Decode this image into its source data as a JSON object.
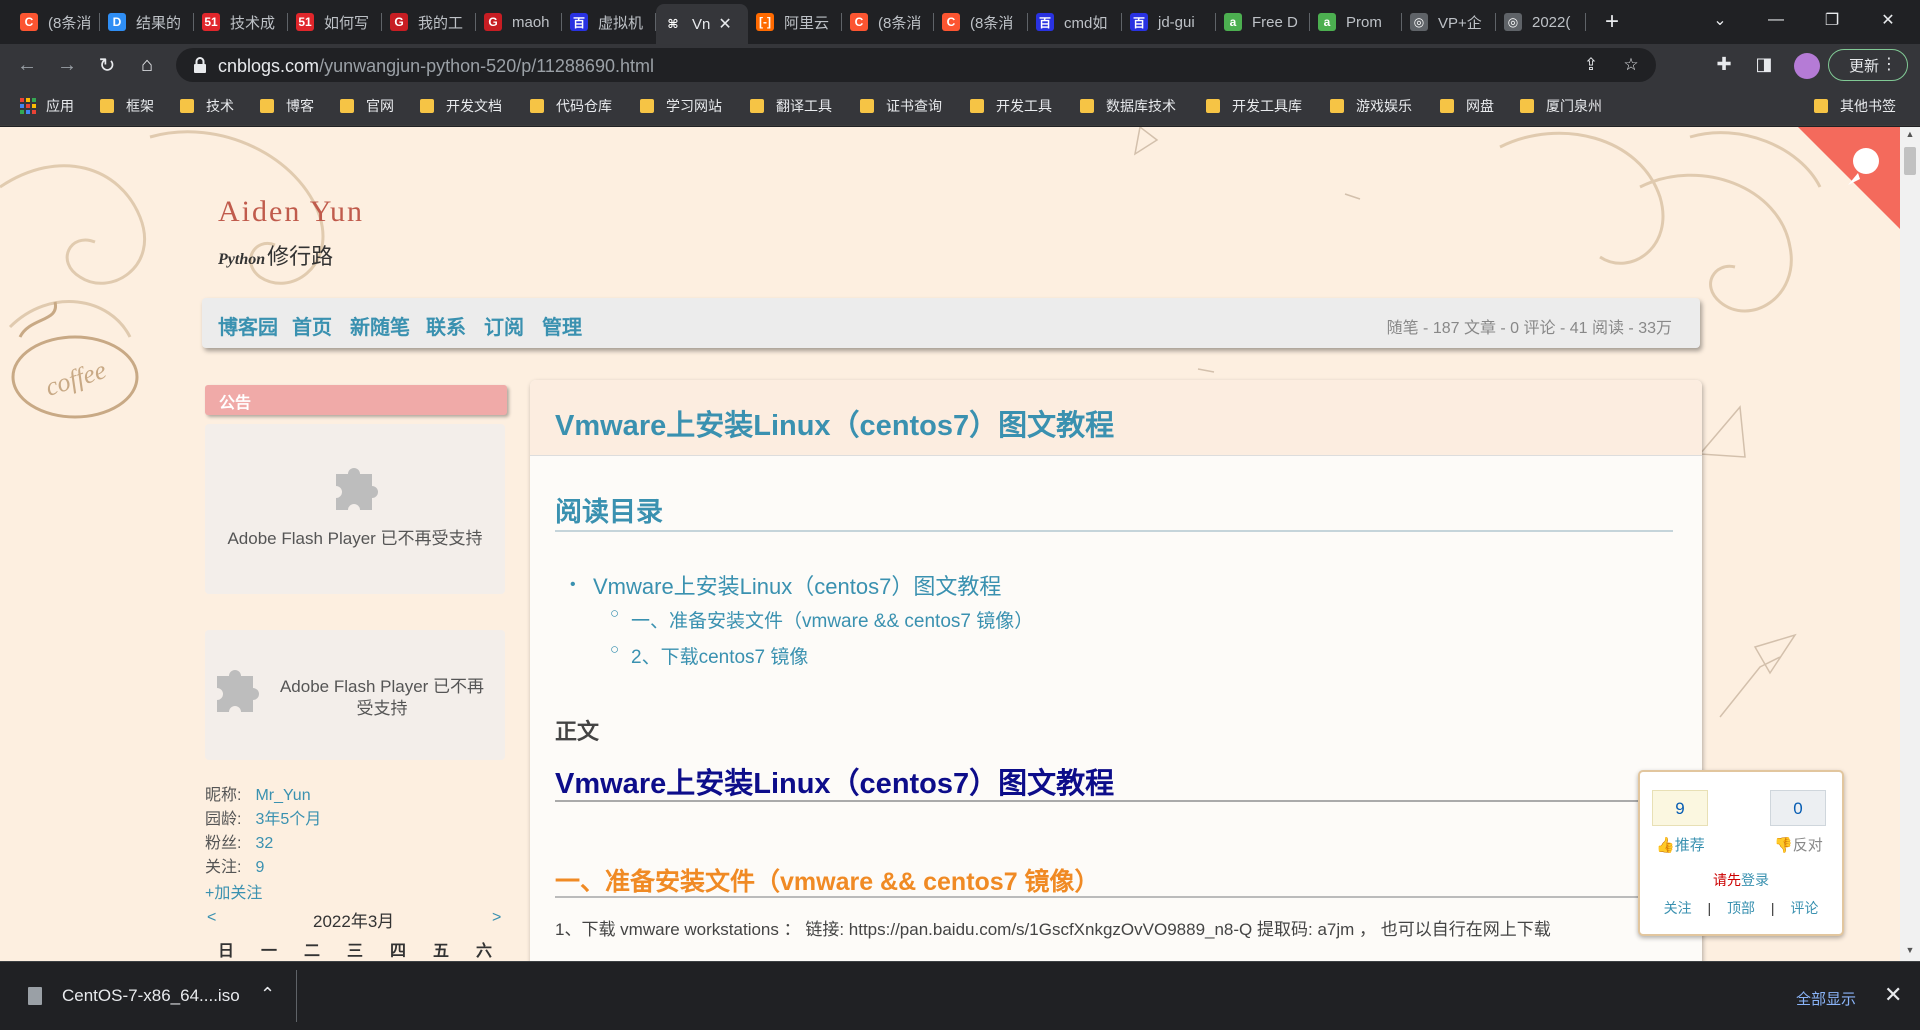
{
  "tabs": [
    {
      "label": "(8条消",
      "icon": "csdn-icon",
      "color": "#fc5531",
      "glyph": "C"
    },
    {
      "label": "结果的",
      "icon": "doc-icon",
      "color": "#2f8ef4",
      "glyph": "D"
    },
    {
      "label": "技术成",
      "icon": "51cto-icon",
      "color": "#e0262b",
      "glyph": "51"
    },
    {
      "label": "如何写",
      "icon": "51cto-icon",
      "color": "#e0262b",
      "glyph": "51"
    },
    {
      "label": "我的工",
      "icon": "gitee-icon",
      "color": "#c71d23",
      "glyph": "G"
    },
    {
      "label": "maoh",
      "icon": "gitee-icon",
      "color": "#c71d23",
      "glyph": "G"
    },
    {
      "label": "虚拟机",
      "icon": "baidu-icon",
      "color": "#2932e1",
      "glyph": "百"
    },
    {
      "label": "Vn",
      "icon": "cnblogs-icon",
      "color": "#35363a",
      "glyph": "⌘",
      "active": true
    },
    {
      "label": "阿里云",
      "icon": "aliyun-icon",
      "color": "#ff6a00",
      "glyph": "[-]"
    },
    {
      "label": "(8条消",
      "icon": "csdn-icon",
      "color": "#fc5531",
      "glyph": "C"
    },
    {
      "label": "(8条消",
      "icon": "csdn-icon",
      "color": "#fc5531",
      "glyph": "C"
    },
    {
      "label": "cmd如",
      "icon": "baidu-icon",
      "color": "#2932e1",
      "glyph": "百"
    },
    {
      "label": "jd-gui",
      "icon": "baidu-icon",
      "color": "#2932e1",
      "glyph": "百"
    },
    {
      "label": "Free D",
      "icon": "green-a-icon",
      "color": "#4caf50",
      "glyph": "a"
    },
    {
      "label": "Prom",
      "icon": "green-a-icon",
      "color": "#4caf50",
      "glyph": "a"
    },
    {
      "label": "VP+企",
      "icon": "globe-icon",
      "color": "#5f6368",
      "glyph": "◎"
    },
    {
      "label": "2022(",
      "icon": "globe-icon",
      "color": "#5f6368",
      "glyph": "◎"
    }
  ],
  "url": {
    "host": "cnblogs.com",
    "path": "/yunwangjun-python-520/p/11288690.html"
  },
  "update_label": "更新",
  "bookmarks": [
    "应用",
    "框架",
    "技术",
    "博客",
    "官网",
    "开发文档",
    "代码仓库",
    "学习网站",
    "翻译工具",
    "证书查询",
    "开发工具",
    "数据库技术",
    "开发工具库",
    "游戏娱乐",
    "网盘",
    "厦门泉州"
  ],
  "other_bookmarks": "其他书签",
  "blog": {
    "title": "Aiden Yun",
    "subtitle_script": "Python",
    "subtitle": "修行路"
  },
  "nav": {
    "links": [
      "博客园",
      "首页",
      "新随笔",
      "联系",
      "订阅",
      "管理"
    ],
    "stats": "随笔 - 187  文章 - 0  评论 - 41  阅读 - 33万"
  },
  "sidebar": {
    "notice_title": "公告",
    "flash1": "Adobe Flash Player 已不再受支持",
    "flash2": "Adobe Flash Player 已不再受支持",
    "profile": {
      "nickname_label": "昵称:",
      "nickname": "Mr_Yun",
      "age_label": "园龄:",
      "age": "3年5个月",
      "fans_label": "粉丝:",
      "fans": "32",
      "following_label": "关注:",
      "following": "9"
    },
    "follow_link": "+加关注",
    "calendar": {
      "prev": "<",
      "next": ">",
      "title": "2022年3月",
      "days": [
        "日",
        "一",
        "二",
        "三",
        "四",
        "五",
        "六"
      ]
    }
  },
  "post": {
    "title": "Vmware上安装Linux（centos7）图文教程",
    "toc_title": "阅读目录",
    "toc": [
      "Vmware上安装Linux（centos7）图文教程",
      "一、准备安装文件（vmware && centos7 镜像）",
      "2、下载centos7 镜像"
    ],
    "body_heading": "正文",
    "h1": "Vmware上安装Linux（centos7）图文教程",
    "h2": "一、准备安装文件（vmware && centos7 镜像）",
    "para": "1、下载  vmware workstations ： 链接: https://pan.baidu.com/s/1GscfXnkgzOvVO9889_n8-Q 提取码: a7jm ， 也可以自行在网上下载"
  },
  "vote": {
    "up": "9",
    "up_label": "推荐",
    "down": "0",
    "down_label": "反对",
    "login_prefix": "请先",
    "login_link": "登录",
    "links": [
      "关注",
      "顶部",
      "评论"
    ]
  },
  "download": {
    "filename": "CentOS-7-x86_64....iso",
    "show_all": "全部显示"
  }
}
